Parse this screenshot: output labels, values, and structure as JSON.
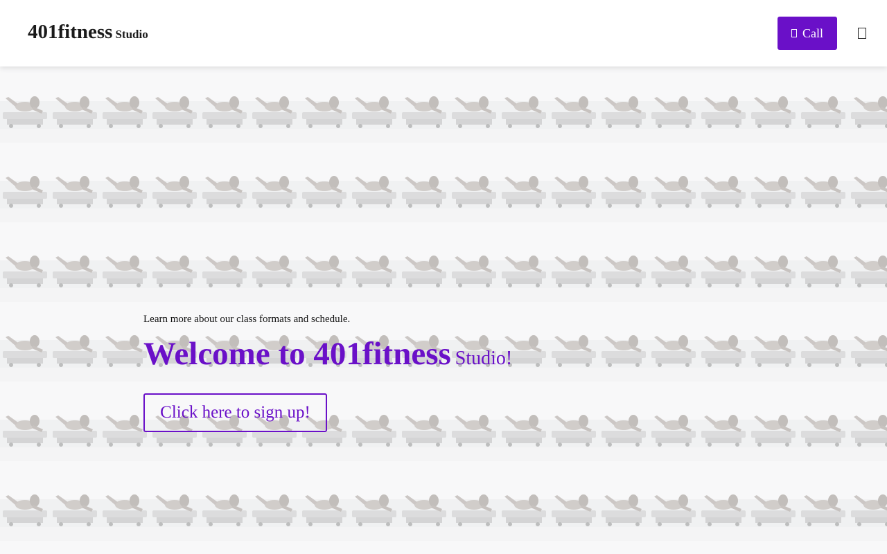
{
  "header": {
    "brand_main": "401fitness",
    "brand_sub": "Studio",
    "call_label": "Call",
    "call_icon": "phone-icon",
    "menu_icon": "menu-icon"
  },
  "hero": {
    "intro": "Learn more about our class formats and schedule.",
    "title_main": "Welcome to 401fitness",
    "title_sub": "Studio!",
    "signup_label": "Click here to sign up!",
    "background_image": "pilates-reformer-photo-tiled"
  },
  "colors": {
    "accent": "#6a10c8",
    "header_bg": "#ffffff",
    "text": "#1a1a1a"
  }
}
